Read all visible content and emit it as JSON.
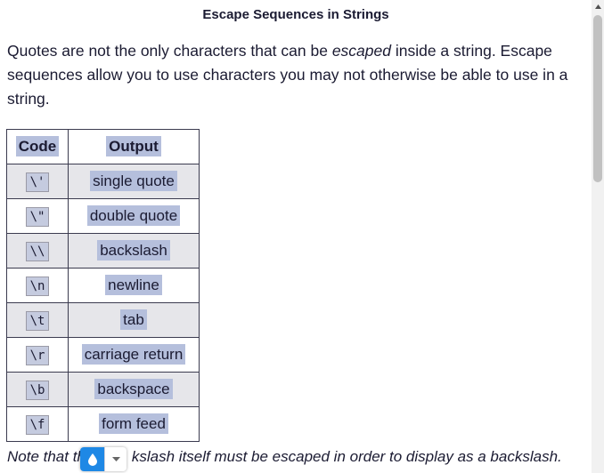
{
  "heading": "Escape Sequences in Strings",
  "intro": {
    "before": "Quotes are not the only characters that can be ",
    "emphasis": "escaped",
    "after": " inside a string. Escape sequences allow you to use characters you may not otherwise be able to use in a string."
  },
  "table": {
    "headers": {
      "code": "Code",
      "output": "Output"
    },
    "rows": [
      {
        "code": "\\'",
        "output": "single quote"
      },
      {
        "code": "\\\"",
        "output": "double quote"
      },
      {
        "code": "\\\\",
        "output": "backslash"
      },
      {
        "code": "\\n",
        "output": "newline"
      },
      {
        "code": "\\t",
        "output": "tab"
      },
      {
        "code": "\\r",
        "output": "carriage return"
      },
      {
        "code": "\\b",
        "output": "backspace"
      },
      {
        "code": "\\f",
        "output": "form feed"
      }
    ]
  },
  "note": {
    "before": "Note that th",
    "after": "kslash itself must be escaped in order to display as a backslash."
  },
  "colors": {
    "selection": "#b5bfdc",
    "row_alt": "#e6e6ea",
    "widget_accent": "#1e88e5"
  }
}
